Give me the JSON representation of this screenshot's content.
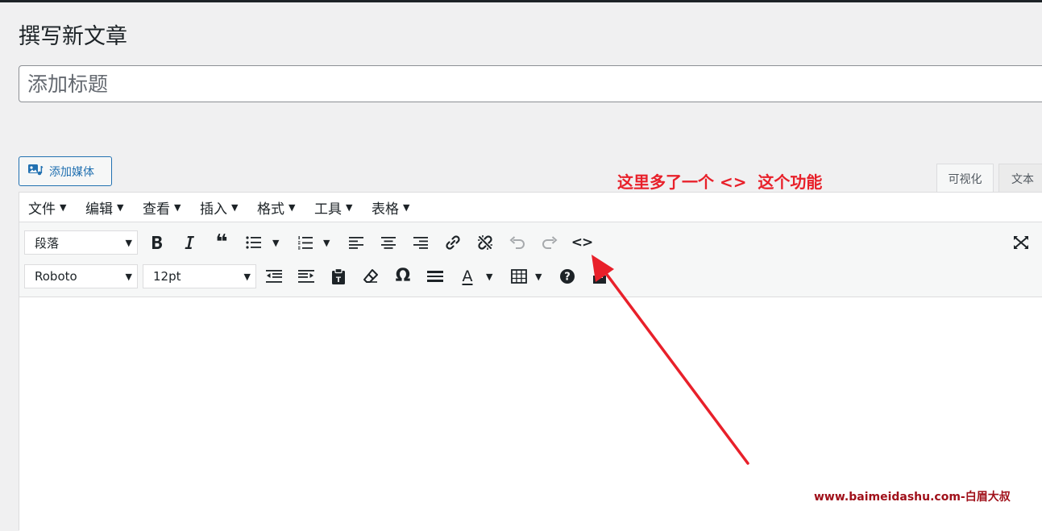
{
  "page": {
    "title": "撰写新文章"
  },
  "post_title": {
    "placeholder": "添加标题",
    "value": ""
  },
  "toolbar_top": {
    "add_media_label": "添加媒体"
  },
  "editor_tabs": {
    "visual": "可视化",
    "text": "文本"
  },
  "menubar": {
    "items": [
      {
        "label": "文件"
      },
      {
        "label": "编辑"
      },
      {
        "label": "查看"
      },
      {
        "label": "插入"
      },
      {
        "label": "格式"
      },
      {
        "label": "工具"
      },
      {
        "label": "表格"
      }
    ]
  },
  "format_toolbar": {
    "paragraph_select": "段落",
    "font_family_select": "Roboto",
    "font_size_select": "12pt",
    "quote_glyph": "❝",
    "special_char_glyph": "Ω",
    "text_color_glyph": "A",
    "code_glyph": "<>"
  },
  "annotation": {
    "text": "这里多了一个 <>  这个功能",
    "color": "#e8202a"
  },
  "watermark": {
    "text": "www.baimeidashu.com-白眉大叔",
    "color": "#a0101a"
  },
  "colors": {
    "accent": "#2271b1",
    "background": "#f0f0f1"
  }
}
